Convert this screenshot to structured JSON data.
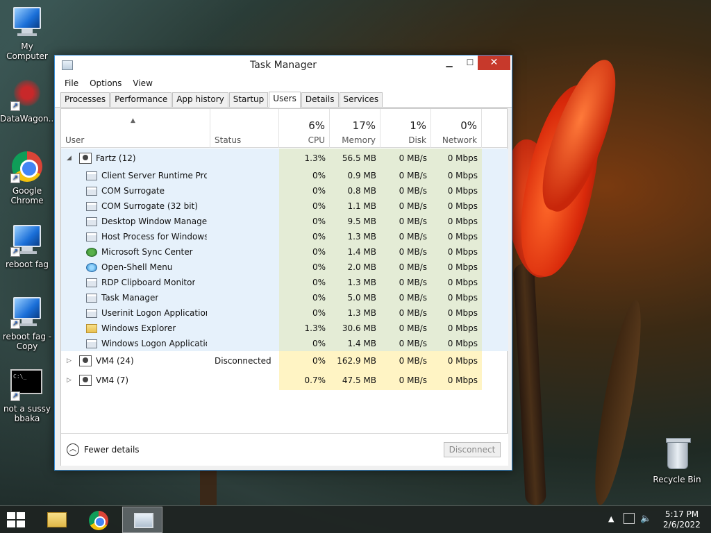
{
  "desktop": {
    "icons": [
      {
        "label": "My Computer"
      },
      {
        "label": "DataWagon..."
      },
      {
        "label": "Google Chrome"
      },
      {
        "label": "reboot fag"
      },
      {
        "label": "reboot fag - Copy"
      },
      {
        "label": "not a sussy bbaka"
      },
      {
        "label": "Recycle Bin"
      }
    ]
  },
  "window": {
    "title": "Task Manager",
    "menu": [
      "File",
      "Options",
      "View"
    ],
    "tabs": [
      "Processes",
      "Performance",
      "App history",
      "Startup",
      "Users",
      "Details",
      "Services"
    ],
    "active_tab": "Users",
    "columns": {
      "user": "User",
      "status": "Status",
      "cpu": {
        "pct": "6%",
        "label": "CPU"
      },
      "memory": {
        "pct": "17%",
        "label": "Memory"
      },
      "disk": {
        "pct": "1%",
        "label": "Disk"
      },
      "network": {
        "pct": "0%",
        "label": "Network"
      }
    },
    "groups": [
      {
        "name": "Fartz (12)",
        "status": "",
        "cpu": "1.3%",
        "memory": "56.5 MB",
        "disk": "0 MB/s",
        "network": "0 Mbps",
        "expanded": true,
        "processes": [
          {
            "name": "Client Server Runtime Proc...",
            "icon": "window-icon",
            "cpu": "0%",
            "memory": "0.9 MB",
            "disk": "0 MB/s",
            "network": "0 Mbps"
          },
          {
            "name": "COM Surrogate",
            "icon": "window-icon",
            "cpu": "0%",
            "memory": "0.8 MB",
            "disk": "0 MB/s",
            "network": "0 Mbps"
          },
          {
            "name": "COM Surrogate (32 bit)",
            "icon": "window-icon",
            "cpu": "0%",
            "memory": "1.1 MB",
            "disk": "0 MB/s",
            "network": "0 Mbps"
          },
          {
            "name": "Desktop Window Manager",
            "icon": "window-icon",
            "cpu": "0%",
            "memory": "9.5 MB",
            "disk": "0 MB/s",
            "network": "0 Mbps"
          },
          {
            "name": "Host Process for Windows ...",
            "icon": "window-icon",
            "cpu": "0%",
            "memory": "1.3 MB",
            "disk": "0 MB/s",
            "network": "0 Mbps"
          },
          {
            "name": "Microsoft Sync Center",
            "icon": "sync-icon",
            "cpu": "0%",
            "memory": "1.4 MB",
            "disk": "0 MB/s",
            "network": "0 Mbps"
          },
          {
            "name": "Open-Shell Menu",
            "icon": "shell-icon",
            "cpu": "0%",
            "memory": "2.0 MB",
            "disk": "0 MB/s",
            "network": "0 Mbps"
          },
          {
            "name": "RDP Clipboard Monitor",
            "icon": "window-icon",
            "cpu": "0%",
            "memory": "1.3 MB",
            "disk": "0 MB/s",
            "network": "0 Mbps"
          },
          {
            "name": "Task Manager",
            "icon": "task-manager-icon",
            "cpu": "0%",
            "memory": "5.0 MB",
            "disk": "0 MB/s",
            "network": "0 Mbps"
          },
          {
            "name": "Userinit Logon Application",
            "icon": "window-icon",
            "cpu": "0%",
            "memory": "1.3 MB",
            "disk": "0 MB/s",
            "network": "0 Mbps"
          },
          {
            "name": "Windows Explorer",
            "icon": "folder-icon",
            "cpu": "1.3%",
            "memory": "30.6 MB",
            "disk": "0 MB/s",
            "network": "0 Mbps"
          },
          {
            "name": "Windows Logon Application",
            "icon": "window-icon",
            "cpu": "0%",
            "memory": "1.4 MB",
            "disk": "0 MB/s",
            "network": "0 Mbps"
          }
        ]
      },
      {
        "name": "VM4 (24)",
        "status": "Disconnected",
        "cpu": "0%",
        "memory": "162.9 MB",
        "disk": "0 MB/s",
        "network": "0 Mbps",
        "expanded": false
      },
      {
        "name": "VM4 (7)",
        "status": "",
        "cpu": "0.7%",
        "memory": "47.5 MB",
        "disk": "0 MB/s",
        "network": "0 Mbps",
        "expanded": false
      }
    ],
    "footer": {
      "fewer_details": "Fewer details",
      "disconnect": "Disconnect"
    }
  },
  "taskbar": {
    "time": "5:17 PM",
    "date": "2/6/2022"
  }
}
